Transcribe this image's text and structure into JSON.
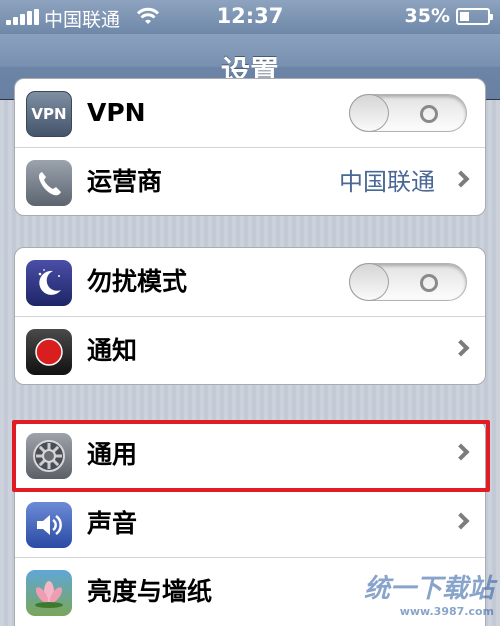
{
  "status_bar": {
    "carrier": "中国联通",
    "time": "12:37",
    "battery_percent_text": "35%",
    "battery_level": 0.35,
    "icons": [
      "signal-icon",
      "wifi-icon",
      "battery-icon"
    ]
  },
  "nav": {
    "title": "设置"
  },
  "groups": [
    {
      "cells": [
        {
          "label": "VPN",
          "icon": "vpn-icon",
          "switch_on": false
        },
        {
          "label": "运营商",
          "icon": "phone-icon",
          "value": "中国联通"
        }
      ]
    },
    {
      "cells": [
        {
          "label": "勿扰模式",
          "icon": "moon-icon",
          "switch_on": false
        },
        {
          "label": "通知",
          "icon": "notification-icon"
        }
      ]
    },
    {
      "cells": [
        {
          "label": "通用",
          "icon": "gear-icon",
          "highlighted": true
        },
        {
          "label": "声音",
          "icon": "speaker-icon"
        },
        {
          "label": "亮度与墙纸",
          "icon": "flower-icon"
        }
      ]
    }
  ],
  "colors": {
    "highlight_box": "#e01c24",
    "value_text": "#4a6896",
    "nav_bar": "#7990b0"
  },
  "watermark": {
    "text": "统一下载站",
    "url": "www.3987.com"
  }
}
